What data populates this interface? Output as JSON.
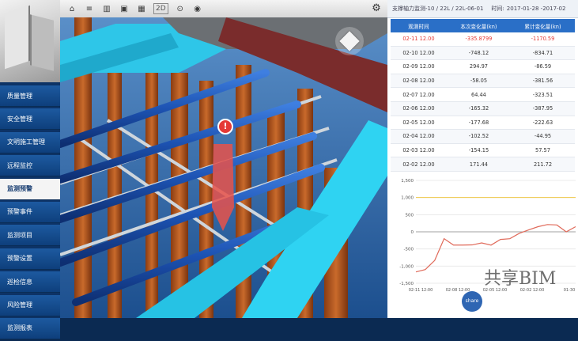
{
  "sidebar": {
    "items": [
      {
        "label": "质量管理",
        "active": false
      },
      {
        "label": "安全管理",
        "active": false
      },
      {
        "label": "文明施工管理",
        "active": false
      },
      {
        "label": "远程监控",
        "active": false
      },
      {
        "label": "监测预警",
        "active": true
      },
      {
        "label": "预警事件",
        "active": false
      },
      {
        "label": "监测项目",
        "active": false
      },
      {
        "label": "预警设置",
        "active": false
      },
      {
        "label": "巡检信息",
        "active": false
      },
      {
        "label": "风险管理",
        "active": false
      },
      {
        "label": "监测报表",
        "active": false
      }
    ]
  },
  "toolbar": {
    "icons": [
      "home-icon",
      "layers-icon",
      "building-icon",
      "toolbox-icon",
      "grid-icon",
      "2d-icon",
      "location-pin-icon",
      "eye-icon"
    ],
    "view_mode": "2D"
  },
  "panel": {
    "path": "支撑轴力监测-10 / 22L / 22L-06-01",
    "time_label": "时间:",
    "time_value": "2017-01-28 -2017-02",
    "columns": [
      "观测时间",
      "本次变化量(kn)",
      "累计变化量(kn)"
    ],
    "rows": [
      [
        "02-11 12.00",
        "-335.8799",
        "-1170.59"
      ],
      [
        "02-10 12.00",
        "-748.12",
        "-834.71"
      ],
      [
        "02-09 12.00",
        "294.97",
        "-86.59"
      ],
      [
        "02-08 12.00",
        "-58.05",
        "-381.56"
      ],
      [
        "02-07 12.00",
        "64.44",
        "-323.51"
      ],
      [
        "02-06 12.00",
        "-165.32",
        "-387.95"
      ],
      [
        "02-05 12.00",
        "-177.68",
        "-222.63"
      ],
      [
        "02-04 12.00",
        "-102.52",
        "-44.95"
      ],
      [
        "02-03 12.00",
        "-154.15",
        "57.57"
      ],
      [
        "02-02 12.00",
        "171.44",
        "211.72"
      ]
    ]
  },
  "chart_data": {
    "type": "line",
    "yticks": [
      "1,500",
      "1,000",
      "500",
      "0",
      "-500",
      "-1,000",
      "-1,500"
    ],
    "ylim": [
      -1500,
      1500
    ],
    "xticks": [
      "02-11 12:00",
      "02-08 12:00",
      "02-05 12:00",
      "02-02 12:00",
      "01-30"
    ],
    "threshold": 1000,
    "series": [
      {
        "values": [
          -1170.59,
          -1100,
          -834.71,
          -200,
          -386,
          -386,
          -381.56,
          -323.51,
          -387.95,
          -222.63,
          -200,
          -44.95,
          57.57,
          150,
          211.72,
          200,
          0,
          150
        ]
      }
    ],
    "colors": {
      "line": "#e06a5a",
      "threshold": "#f0c84a",
      "axis": "#888888"
    }
  },
  "watermark": {
    "text": "共享BIM",
    "badge": "share"
  },
  "colors": {
    "accent": "#2a6fc7",
    "warn": "#e53935",
    "sidebar": "#0d3366"
  }
}
